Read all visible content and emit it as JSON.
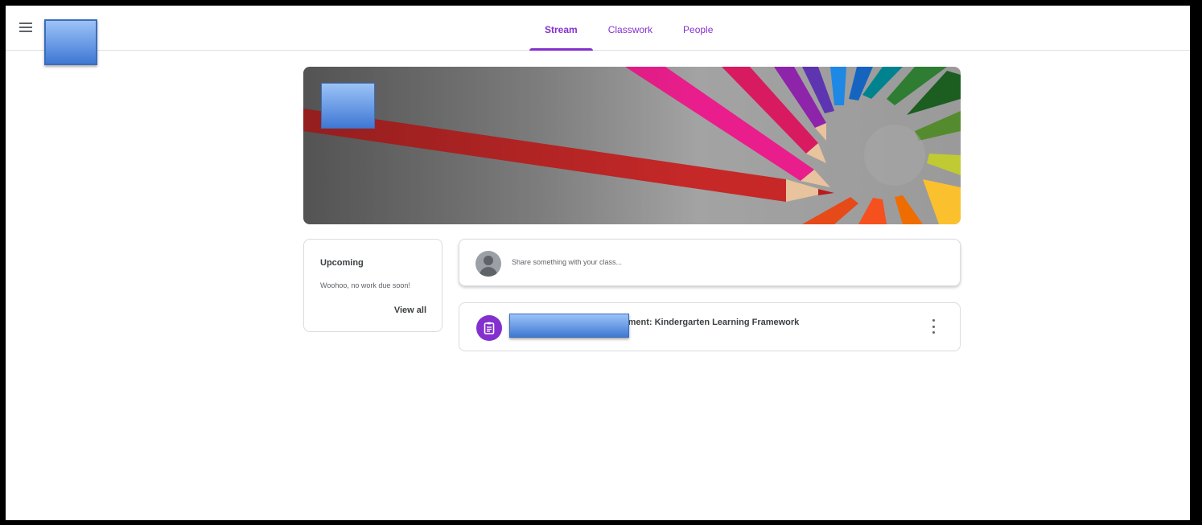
{
  "header": {
    "tabs": [
      {
        "label": "Stream",
        "active": true
      },
      {
        "label": "Classwork",
        "active": false
      },
      {
        "label": "People",
        "active": false
      }
    ]
  },
  "upcoming": {
    "title": "Upcoming",
    "message": "Woohoo, no work due soon!",
    "view_all": "View all"
  },
  "share": {
    "placeholder": "Share something with your class..."
  },
  "post": {
    "text": "ew assignment: Kindergarten Learning Framework",
    "icon": "assignment-icon"
  },
  "colors": {
    "accent": "#8430ce",
    "text": "#3c4043",
    "muted": "#5f6368",
    "border": "#dadce0"
  }
}
